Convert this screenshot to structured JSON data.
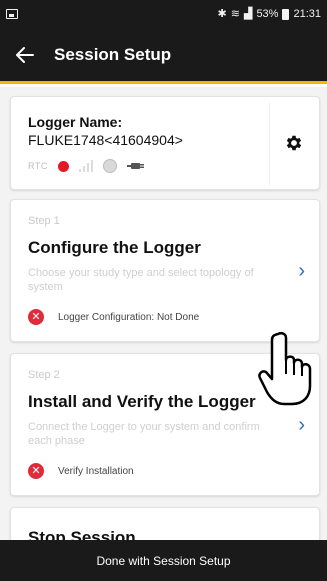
{
  "status_bar": {
    "signal_glyph": "≋",
    "battery": "53%",
    "time": "21:31"
  },
  "app_bar": {
    "title": "Session Setup"
  },
  "logger_card": {
    "label": "Logger Name:",
    "value": "FLUKE1748<41604904>",
    "rtc_label": "RTC"
  },
  "steps": [
    {
      "number": "Step 1",
      "title": "Configure the Logger",
      "description": "Choose your study type and select topology of system",
      "status": "Logger Configuration: Not Done"
    },
    {
      "number": "Step 2",
      "title": "Install and Verify the Logger",
      "description": "Connect the Logger to your system and confirm each phase",
      "status": "Verify Installation"
    },
    {
      "title": "Stop Session"
    }
  ],
  "bottom_bar": {
    "done_label": "Done with Session Setup"
  },
  "colors": {
    "app_bar": "#1a1a1a",
    "accent_underline": "#f5b800",
    "error_red": "#e02b3a",
    "chevron_blue": "#2a6bd1"
  }
}
